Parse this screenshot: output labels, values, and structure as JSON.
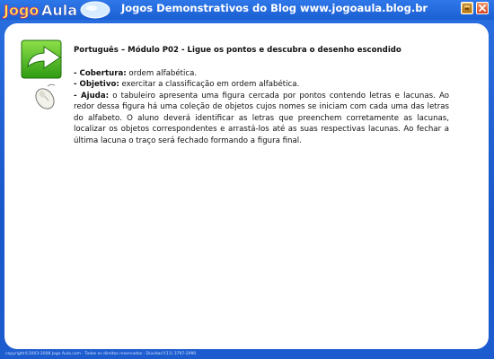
{
  "window": {
    "logo_text": "JogoAula",
    "title": "Jogos Demonstrativos do Blog www.jogoaula.blog.br",
    "minimize_icon": "minimize-icon",
    "close_icon": "close-icon"
  },
  "content": {
    "heading": "Português – Módulo P02 - Ligue os pontos e descubra o desenho escondido",
    "cobertura_label": "- Cobertura:",
    "cobertura_text": " ordem alfabética.",
    "objetivo_label": "- Objetivo:",
    "objetivo_text": " exercitar a classificação em ordem alfabética.",
    "ajuda_label": "- Ajuda:",
    "ajuda_text": " o tabuleiro apresenta uma figura cercada por pontos contendo letras e lacunas. Ao redor dessa figura há uma coleção de  objetos cujos nomes se iniciam com cada uma das letras do alfabeto. O aluno deverá identificar as letras que preenchem corretamente as lacunas, localizar os objetos correspondentes e arrastá-los até as suas respectivas lacunas. Ao fechar a última lacuna o traço será fechado formando a figura final."
  },
  "icons": {
    "start": "green-arrow-icon",
    "mouse": "mouse-icon"
  },
  "status": {
    "text": "copyright©2003-2008 Jogo Aula.com - Todos os direitos reservados - Dúvidas?(11) 3797-2990"
  }
}
